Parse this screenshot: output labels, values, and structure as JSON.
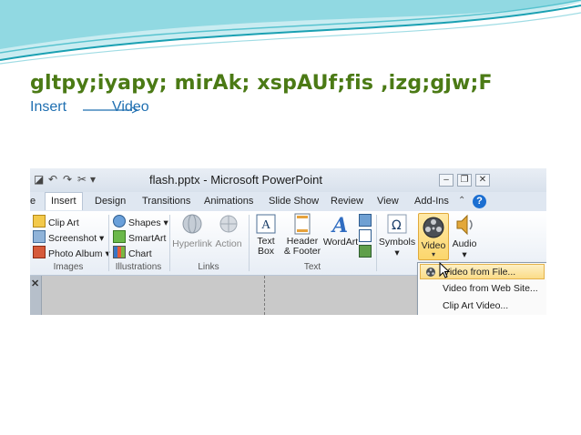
{
  "slide": {
    "title": "gltpy;iyapy; mirAk;  xspAUf;fis ,izg;gjw;F",
    "subtitle_from": "Insert",
    "subtitle_to": "Video"
  },
  "window": {
    "title": "flash.pptx - Microsoft PowerPoint",
    "tabs": [
      "e",
      "Insert",
      "Design",
      "Transitions",
      "Animations",
      "Slide Show",
      "Review",
      "View",
      "Add-Ins"
    ]
  },
  "ribbon": {
    "images_items": [
      "Clip Art",
      "Screenshot",
      "Photo Album"
    ],
    "images_group": "Images",
    "illustrations_items": [
      "Shapes",
      "SmartArt",
      "Chart"
    ],
    "illustrations_group": "Illustrations",
    "links_items": [
      "Hyperlink",
      "Action"
    ],
    "links_group": "Links",
    "text_items": [
      "Text Box",
      "Header & Footer",
      "WordArt"
    ],
    "text_group": "Text",
    "symbols": "Symbols",
    "video": "Video",
    "audio": "Audio"
  },
  "video_menu": {
    "items": [
      "Video from File...",
      "Video from Web Site...",
      "Clip Art Video..."
    ]
  },
  "colors": {
    "title": "#4b7a15",
    "subtitle": "#1f6fb1",
    "wave": "#2fb6c4"
  }
}
